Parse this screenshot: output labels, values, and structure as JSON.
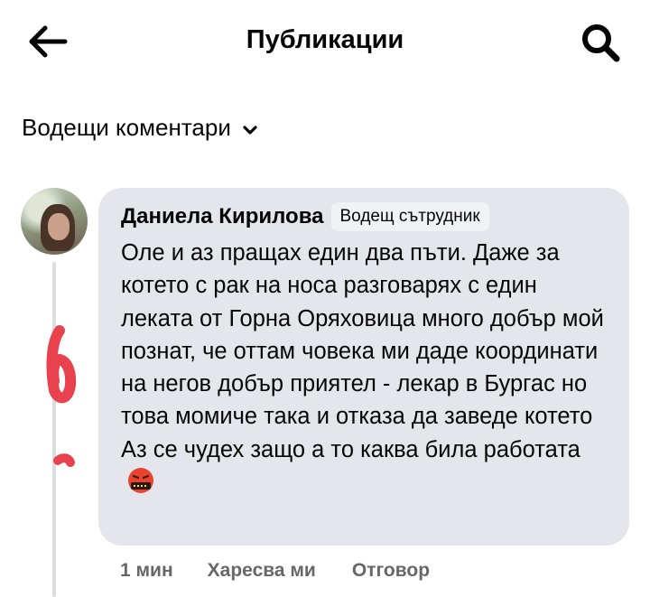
{
  "header": {
    "title": "Публикации",
    "back_icon": "arrow-left-icon",
    "search_icon": "search-icon"
  },
  "filter": {
    "label": "Водещи коментари",
    "icon": "chevron-down-icon"
  },
  "comment": {
    "author": "Даниела Кирилова",
    "badge": "Водещ сътрудник",
    "text": "Оле и аз пращах един два пъти. Даже за котето с рак на носа разговарях с един леката от Горна Оряховица много добър мой познат, че оттам човека ми даде координати на негов добър приятел - лекар в Бургас но това момиче така и отказа да заведе котето Аз се чудех защо а то каква била работата",
    "emoji": "face-with-symbols-on-mouth-emoji",
    "time": "1 мин",
    "like_label": "Харесва ми",
    "reply_label": "Отговор"
  },
  "colors": {
    "bubble": "#e4e6eb",
    "badge_bg": "#f0f2f5",
    "text": "#050505",
    "secondary_text": "#65676b",
    "thread_line": "#dcdde1",
    "scribble": "#e8424f"
  }
}
